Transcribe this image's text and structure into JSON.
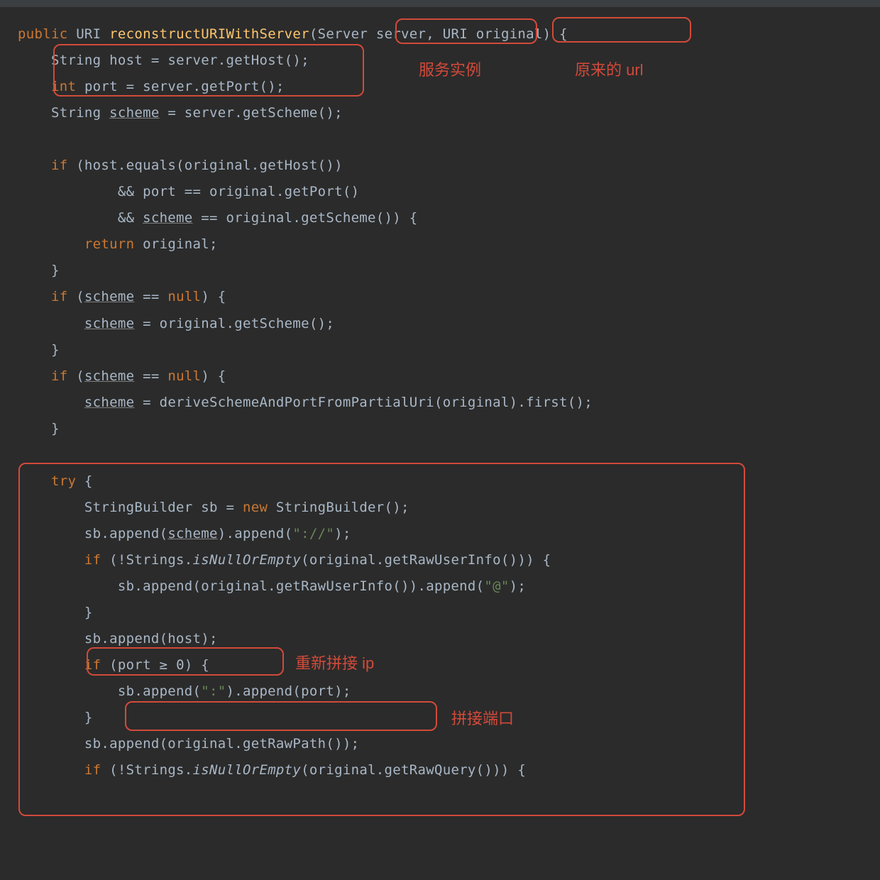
{
  "code": {
    "l1_public": "public",
    "l1_uri": "URI",
    "l1_method": "reconstructURIWithServer",
    "l1_server_t": "Server",
    "l1_server_v": "server",
    "l1_uri2": "URI",
    "l1_orig": "original",
    "l2_string": "String",
    "l2_host": "host = server.getHost();",
    "l3_int": "int",
    "l3_port": "port = server.getPort();",
    "l4_string": "String",
    "l4_scheme": "scheme",
    "l4_rest": " = server.getScheme();",
    "l6_if": "if",
    "l6_cond": " (host.equals(original.getHost())",
    "l7": "&& port == original.getPort()",
    "l8a": "&& ",
    "l8_scheme": "scheme",
    "l8b": " == original.getScheme()) {",
    "l9_return": "return",
    "l9_rest": " original;",
    "l10": "}",
    "l11_if": "if",
    "l11_a": " (",
    "l11_scheme": "scheme",
    "l11_b": " == ",
    "l11_null": "null",
    "l11_c": ") {",
    "l12_scheme": "scheme",
    "l12_rest": " = original.getScheme();",
    "l13": "}",
    "l14_if": "if",
    "l14_a": " (",
    "l14_scheme": "scheme",
    "l14_b": " == ",
    "l14_null": "null",
    "l14_c": ") {",
    "l15_scheme": "scheme",
    "l15_rest": " = deriveSchemeAndPortFromPartialUri(original).first();",
    "l16": "}",
    "l18_try": "try",
    "l18_b": " {",
    "l19_a": "StringBuilder sb = ",
    "l19_new": "new",
    "l19_b": " StringBuilder();",
    "l20_a": "sb.append(",
    "l20_scheme": "scheme",
    "l20_b": ").append(",
    "l20_str": "\"://\"",
    "l20_c": ");",
    "l21_if": "if",
    "l21_a": " (!Strings.",
    "l21_m": "isNullOrEmpty",
    "l21_b": "(original.getRawUserInfo())) {",
    "l22_a": "sb.append(original.getRawUserInfo()).append(",
    "l22_str": "\"@\"",
    "l22_b": ");",
    "l23": "}",
    "l24": "sb.append(host);",
    "l25_if": "if",
    "l25_a": " (port ≥ ",
    "l25_zero": "0",
    "l25_b": ") {",
    "l26_a": "sb.append(",
    "l26_str": "\":\"",
    "l26_b": ").append(port);",
    "l27": "}",
    "l28": "sb.append(original.getRawPath());",
    "l29_if": "if",
    "l29_a": " (!Strings.",
    "l29_m": "isNullOrEmpty",
    "l29_b": "(original.getRawQuery())) {"
  },
  "annotations": {
    "param_server": "服务实例",
    "param_original": "原来的 url",
    "host_block": "",
    "try_block": "",
    "append_host": "重新拼接 ip",
    "append_port": "拼接端口"
  }
}
